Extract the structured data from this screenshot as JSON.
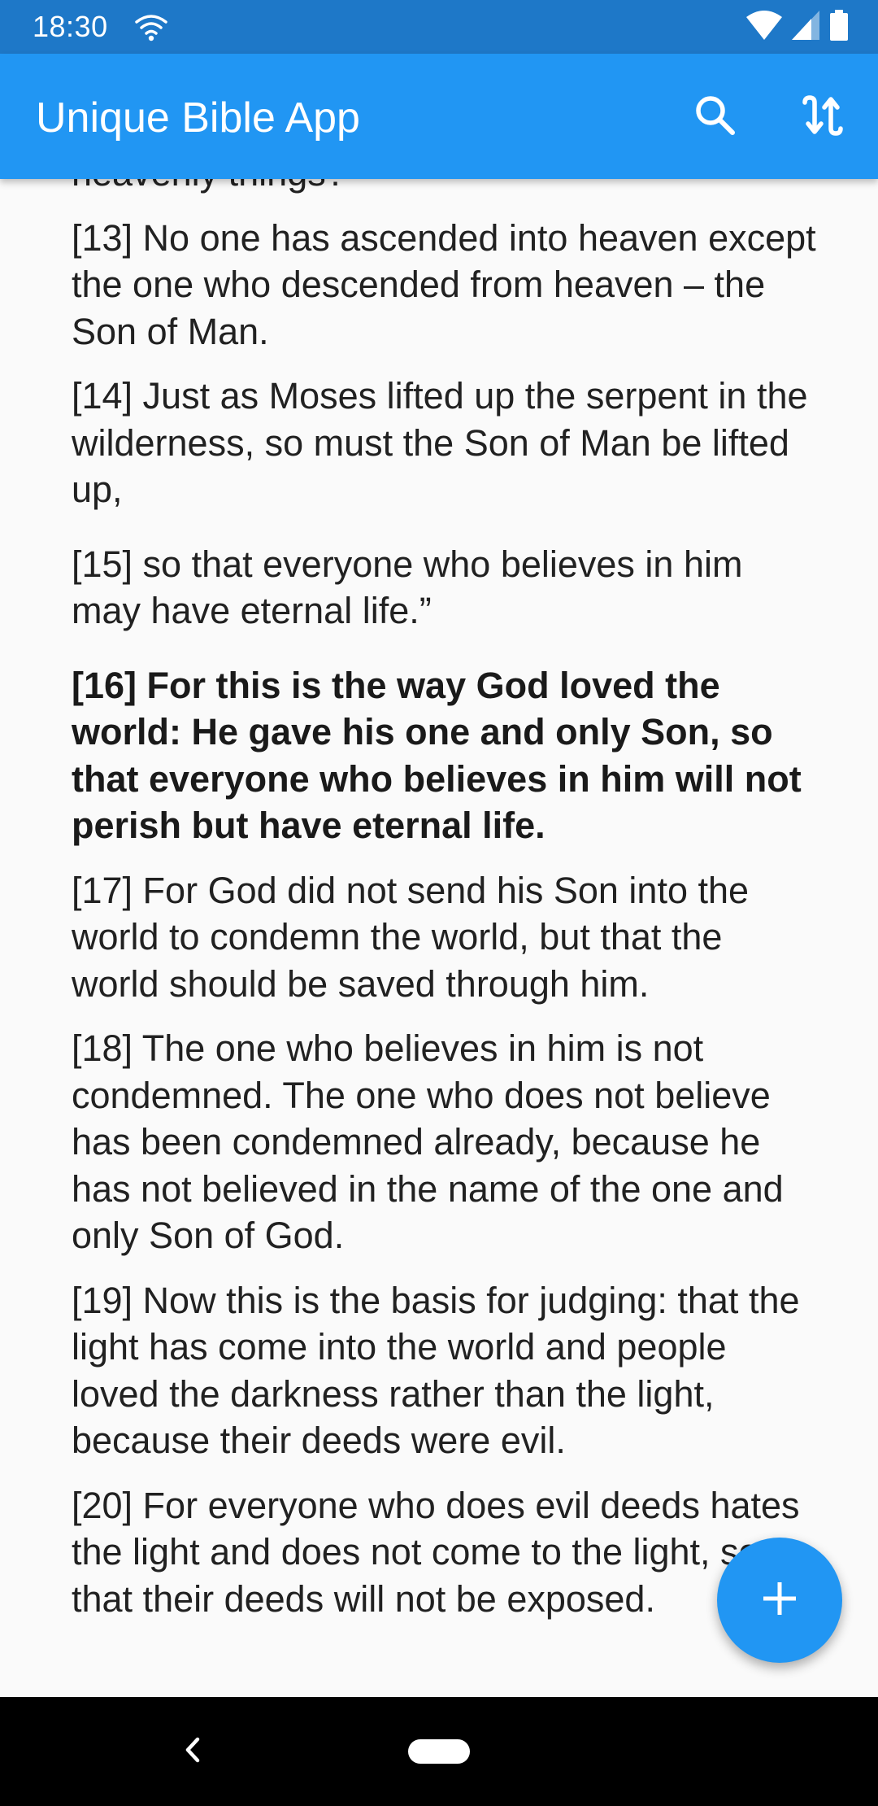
{
  "status_bar": {
    "time": "18:30",
    "icons": [
      "wifi-icon",
      "wifi-signal-icon",
      "cell-signal-icon",
      "battery-icon"
    ]
  },
  "app_bar": {
    "title": "Unique Bible App",
    "actions": [
      "search-icon",
      "sync-swap-icon"
    ],
    "color": "#2196f3"
  },
  "verses": [
    {
      "text": "heavenly things?"
    },
    {
      "text": "[13] No one has ascended into heaven except the one who descended from heaven – the Son of Man."
    },
    {
      "text": "[14] Just as Moses lifted up the serpent in the wilderness, so must the Son of Man be lifted up,"
    },
    {
      "text": "[15] so that everyone who believes in him may have eternal life.”"
    },
    {
      "text": "[16] For this is the way God loved the world: He gave his one and only Son, so that everyone who believes in him will not perish but have eternal life."
    },
    {
      "text": "[17] For God did not send his Son into the world to condemn the world, but that the world should be saved through him."
    },
    {
      "text": "[18] The one who believes in him is not condemned. The one who does not believe has been condemned already, because he has not believed in the name of the one and only Son of God."
    },
    {
      "text": "[19] Now this is the basis for judging: that the light has come into the world and people loved the darkness rather than the light, because their deeds were evil."
    },
    {
      "text": "[20] For everyone who does evil deeds hates the light and does not come to the light, so that their deeds will not be exposed."
    }
  ],
  "fab": {
    "icon": "plus-icon",
    "color": "#2196f3"
  },
  "nav_bar": {
    "icons": [
      "back-chevron-icon",
      "home-pill-icon"
    ]
  }
}
